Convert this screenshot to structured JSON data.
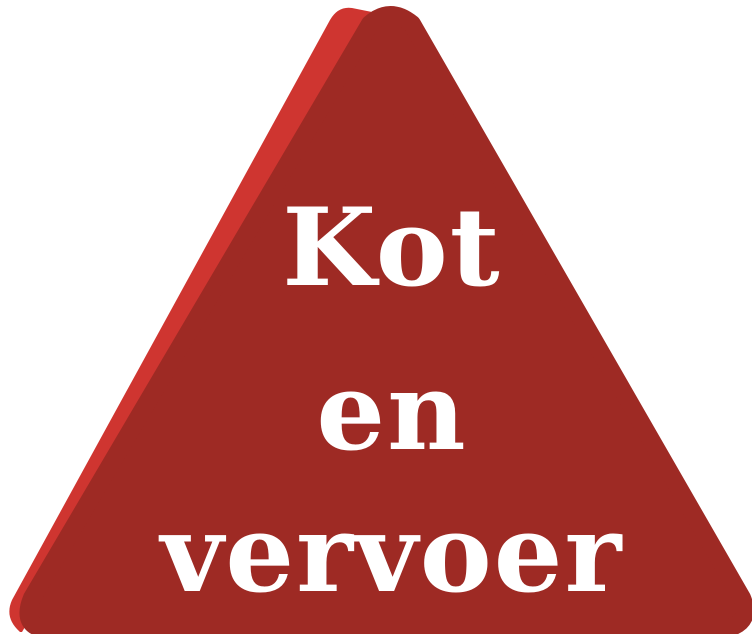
{
  "sign": {
    "lines": [
      "Kot",
      "en",
      "vervoer"
    ],
    "colors": {
      "face": "#9e2a24",
      "edge": "#cf3530",
      "text": "#ffffff",
      "background": "#ffffff"
    }
  }
}
